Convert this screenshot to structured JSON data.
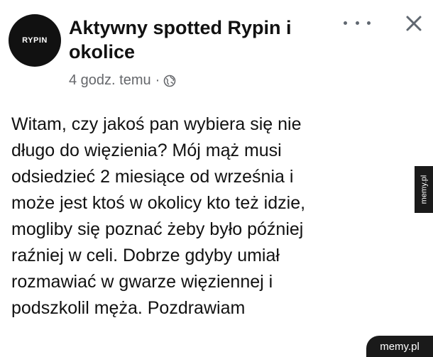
{
  "post": {
    "avatar_text": "RYPIN",
    "group_name": "Aktywny spotted Rypin i okolice",
    "time": "4 godz. temu",
    "separator": "·",
    "privacy_icon": "globe-icon",
    "body_lines": [
      "Witam, czy jakoś pan wybiera się nie",
      "długo do więzienia? Mój mąż musi",
      "odsiedzieć 2 miesiące od września i",
      "może jest ktoś w okolicy kto też idzie,",
      "mogliby się poznać żeby było później",
      "raźniej w celi. Dobrze gdyby umiał",
      "rozmawiać w gwarze więziennej i",
      "podszkolil męża. Pozdrawiam"
    ]
  },
  "actions": {
    "more_icon": "more-icon",
    "close_icon": "close-icon"
  },
  "watermark": {
    "side": "memy.pl",
    "bottom": "memy.pl"
  }
}
